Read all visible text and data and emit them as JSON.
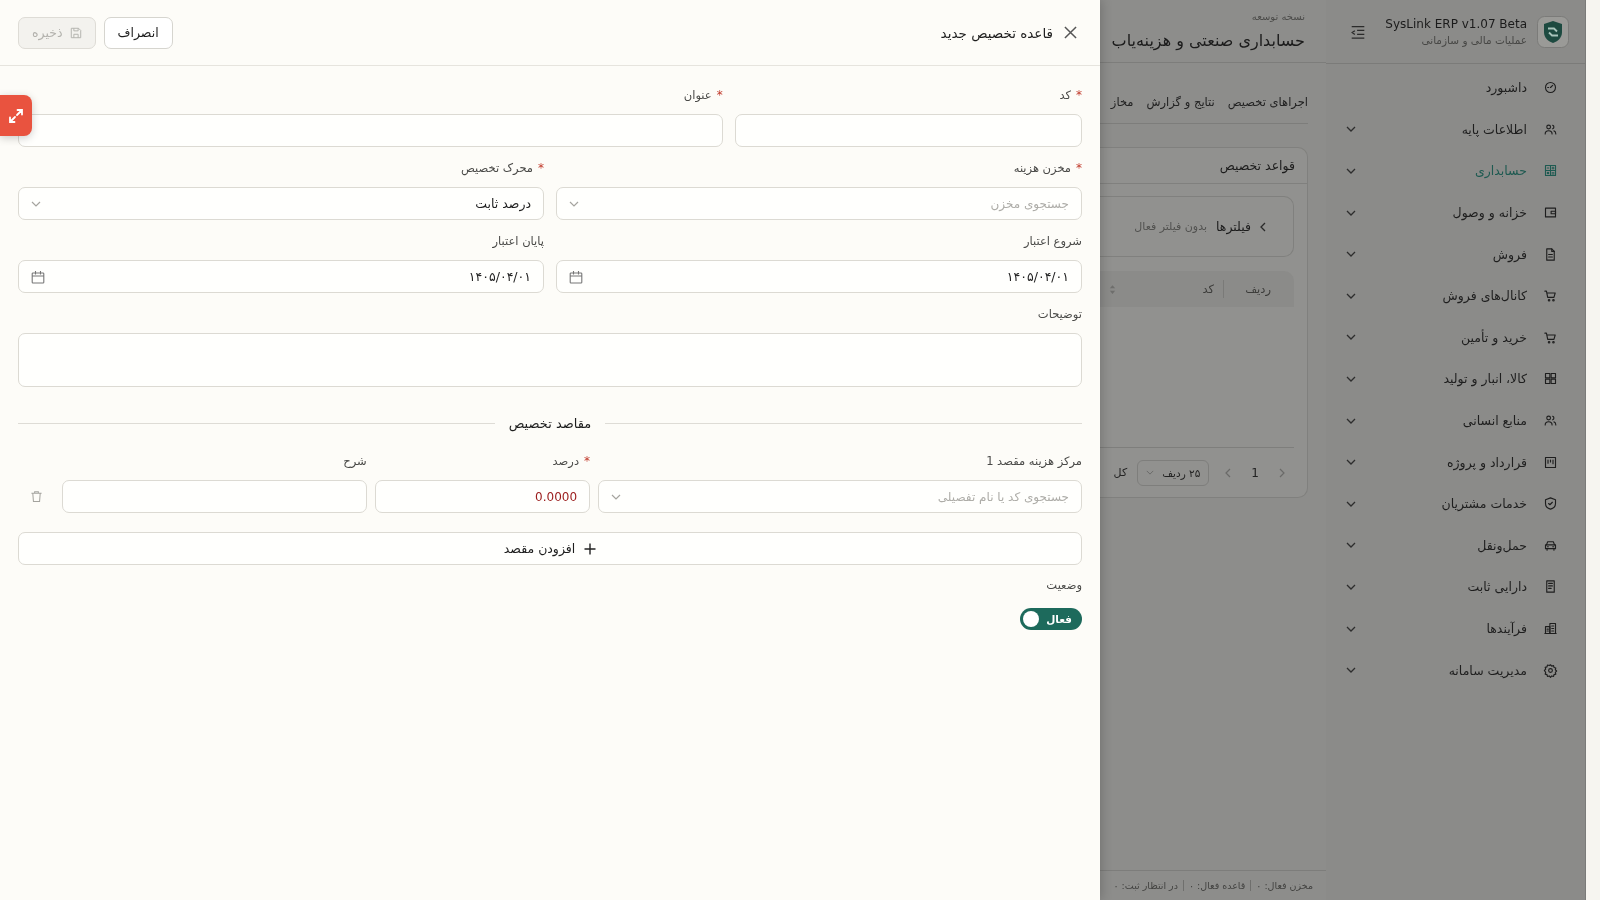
{
  "drawer": {
    "title": "قاعده تخصیص جدید",
    "actions": [
      {
        "label": "انصراف",
        "kind": "cancel",
        "disabled": false
      },
      {
        "label": "ذخیره",
        "kind": "save",
        "disabled": true
      }
    ],
    "rows": [
      {
        "fields": [
          {
            "label": "کد",
            "required_mark": "*",
            "kind": "text"
          },
          {
            "label": "عنوان",
            "required_mark": "*",
            "kind": "text"
          }
        ]
      },
      {
        "fields": [
          {
            "label": "مخزن هزینه",
            "required_mark": "*",
            "kind": "select",
            "placeholder": "جستجوی مخزن"
          },
          {
            "label": "محرک تخصیص",
            "required_mark": "*",
            "kind": "select",
            "value": "درصد ثابت"
          }
        ]
      },
      {
        "fields": [
          {
            "label": "شروع اعتبار",
            "kind": "date",
            "value": "۱۴۰۵/۰۴/۰۱"
          },
          {
            "label": "پایان اعتبار",
            "kind": "date",
            "value": "۱۴۰۵/۰۴/۰۱"
          }
        ]
      },
      {
        "fields": [
          {
            "label": "توضیحات",
            "kind": "textarea"
          }
        ]
      }
    ],
    "destinations": {
      "title": "مقاصد تخصیص",
      "rows": [
        {
          "cost_center": {
            "label": "مرکز هزینه مقصد 1",
            "placeholder": "جستجوی کد یا نام تفصیلی"
          },
          "percent": {
            "label": "درصد",
            "required_mark": "*",
            "value": "0.0000",
            "invalid": true
          },
          "note": {
            "label": "شرح"
          }
        }
      ],
      "add_button": "افزودن مقصد"
    },
    "status": {
      "label": "وضعیت",
      "toggle": {
        "on": true,
        "text": "فعال"
      }
    }
  },
  "page": {
    "eyebrow": "نسخه توسعه",
    "title": "حسابداری صنعتی و هزینه‌یاب",
    "tabs": [
      {
        "label": "اجراهای تخصیص",
        "selected": false
      },
      {
        "label": "نتایج و گزارش",
        "selected": false
      },
      {
        "label": "مخاز",
        "selected": false
      }
    ],
    "card": {
      "title": "قواعد تخصیص",
      "filter": {
        "label": "فیلترها",
        "summary": "بدون فیلتر فعال"
      },
      "columns": [
        "ردیف",
        "کد"
      ],
      "pagination": {
        "page": "1",
        "page_size": "۲۵ ردیف",
        "total": "کل"
      }
    }
  },
  "status_bar": {
    "items": [
      "مخزن فعال: ۰",
      "قاعده فعال: ۰",
      "در انتظار ثبت: ۰"
    ]
  },
  "sidebar": {
    "brand": {
      "title": "SysLink ERP v1.07 Beta",
      "subtitle": "عملیات مالی و سازمانی"
    },
    "items": [
      {
        "label": "داشبورد",
        "selected": false,
        "expandable": false
      },
      {
        "label": "اطلاعات پایه",
        "selected": false,
        "expandable": true
      },
      {
        "label": "حسابداری",
        "selected": true,
        "expandable": true
      },
      {
        "label": "خزانه و وصول",
        "selected": false,
        "expandable": true
      },
      {
        "label": "فروش",
        "selected": false,
        "expandable": true
      },
      {
        "label": "کانال‌های فروش",
        "selected": false,
        "expandable": true
      },
      {
        "label": "خرید و تأمین",
        "selected": false,
        "expandable": true
      },
      {
        "label": "کالا، انبار و تولید",
        "selected": false,
        "expandable": true
      },
      {
        "label": "منابع انسانی",
        "selected": false,
        "expandable": true
      },
      {
        "label": "قرارداد و پروژه",
        "selected": false,
        "expandable": true
      },
      {
        "label": "خدمات مشتریان",
        "selected": false,
        "expandable": true
      },
      {
        "label": "حمل‌ونقل",
        "selected": false,
        "expandable": true
      },
      {
        "label": "دارایی ثابت",
        "selected": false,
        "expandable": true
      },
      {
        "label": "فرآیندها",
        "selected": false,
        "expandable": true
      },
      {
        "label": "مدیریت سامانه",
        "selected": false,
        "expandable": true
      }
    ]
  }
}
